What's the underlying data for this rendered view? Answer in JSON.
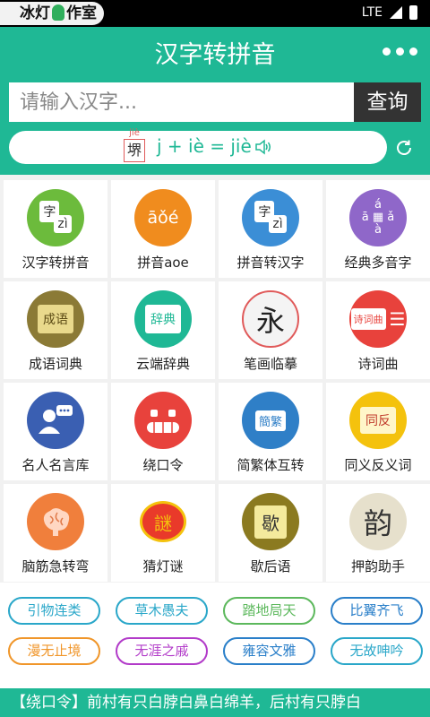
{
  "status_bar": {
    "watermark_left": "冰灯",
    "watermark_right": "作室",
    "network": "LTE"
  },
  "header": {
    "title": "汉字转拼音",
    "more_icon": "more-dots-icon"
  },
  "search": {
    "placeholder": "请输入汉字...",
    "button_label": "查询"
  },
  "result": {
    "char": "堺",
    "char_pinyin": "jiè",
    "formula": "j + iè = jiè",
    "speaker_icon": "speaker-icon",
    "refresh_icon": "refresh-icon"
  },
  "grid": {
    "items": [
      {
        "label": "汉字转拼音",
        "color": "#6cbb3c",
        "icon": "hanzi-pinyin-icon"
      },
      {
        "label": "拼音aoe",
        "color": "#f08c1e",
        "icon": "aoe-icon",
        "glyph": "āǒé"
      },
      {
        "label": "拼音转汉字",
        "color": "#3b8ed6",
        "icon": "pinyin-hanzi-icon"
      },
      {
        "label": "经典多音字",
        "color": "#8f67c9",
        "icon": "duoyinzi-icon"
      },
      {
        "label": "成语词典",
        "color": "#8b7a36",
        "icon": "idiom-book-icon",
        "glyph": "成语"
      },
      {
        "label": "云端辞典",
        "color": "#1fb895",
        "icon": "cloud-dictionary-icon",
        "glyph": "辞典"
      },
      {
        "label": "笔画临摹",
        "color": "#f4f4f4",
        "icon": "stroke-copy-icon",
        "glyph": "永"
      },
      {
        "label": "诗词曲",
        "color": "#e8423c",
        "icon": "poetry-icon",
        "glyph": "诗词曲"
      },
      {
        "label": "名人名言库",
        "color": "#3a5fb2",
        "icon": "quotes-icon"
      },
      {
        "label": "绕口令",
        "color": "#e8423c",
        "icon": "tongue-twister-icon"
      },
      {
        "label": "简繁体互转",
        "color": "#2f7fc7",
        "icon": "simp-trad-icon",
        "glyph": "簡繁"
      },
      {
        "label": "同义反义词",
        "color": "#f4c20d",
        "icon": "synonym-icon",
        "glyph": "同反"
      },
      {
        "label": "脑筋急转弯",
        "color": "#f07f3c",
        "icon": "brain-teaser-icon"
      },
      {
        "label": "猜灯谜",
        "color": "#e93a2a",
        "icon": "lantern-riddle-icon",
        "glyph": "謎"
      },
      {
        "label": "歇后语",
        "color": "#8b7a20",
        "icon": "xiehouyu-icon",
        "glyph": "歇"
      },
      {
        "label": "押韵助手",
        "color": "#e6e0cc",
        "icon": "rhyme-icon",
        "glyph": "韵"
      }
    ]
  },
  "tags": [
    {
      "label": "引物连类",
      "color": "#2aa7c9"
    },
    {
      "label": "草木愚夫",
      "color": "#2aa7c9"
    },
    {
      "label": "踏地局天",
      "color": "#5cb85c"
    },
    {
      "label": "比翼齐飞",
      "color": "#2a7fc9"
    },
    {
      "label": "漫无止境",
      "color": "#f0962a"
    },
    {
      "label": "无涯之戚",
      "color": "#b23bc9"
    },
    {
      "label": "雍容文雅",
      "color": "#2a7fc9"
    },
    {
      "label": "无故呻吟",
      "color": "#2aa7c9"
    }
  ],
  "tongue_twister": {
    "text": "【绕口令】前村有只白脖白鼻白绵羊，后村有只脖白"
  }
}
